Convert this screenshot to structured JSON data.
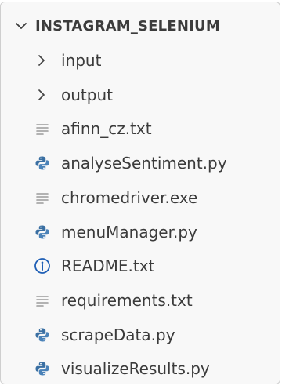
{
  "explorer": {
    "root": {
      "label": "INSTAGRAM_SELENIUM",
      "icon": "chevron-down-icon"
    },
    "items": [
      {
        "kind": "folder",
        "label": "input",
        "icon": "chevron-right-icon"
      },
      {
        "kind": "folder",
        "label": "output",
        "icon": "chevron-right-icon"
      },
      {
        "kind": "file",
        "label": "afinn_cz.txt",
        "icon": "text-file-icon"
      },
      {
        "kind": "file",
        "label": "analyseSentiment.py",
        "icon": "python-icon"
      },
      {
        "kind": "file",
        "label": "chromedriver.exe",
        "icon": "text-file-icon"
      },
      {
        "kind": "file",
        "label": "menuManager.py",
        "icon": "python-icon"
      },
      {
        "kind": "file",
        "label": "README.txt",
        "icon": "info-icon"
      },
      {
        "kind": "file",
        "label": "requirements.txt",
        "icon": "text-file-icon"
      },
      {
        "kind": "file",
        "label": "scrapeData.py",
        "icon": "python-icon"
      },
      {
        "kind": "file",
        "label": "visualizeResults.py",
        "icon": "python-icon"
      }
    ]
  },
  "colors": {
    "background": "#f8f8f8",
    "text": "#3b3b3b",
    "python_icon": "#3a6fa2",
    "info_icon": "#1f5fb5",
    "text_file_icon": "#9a9a9a"
  }
}
